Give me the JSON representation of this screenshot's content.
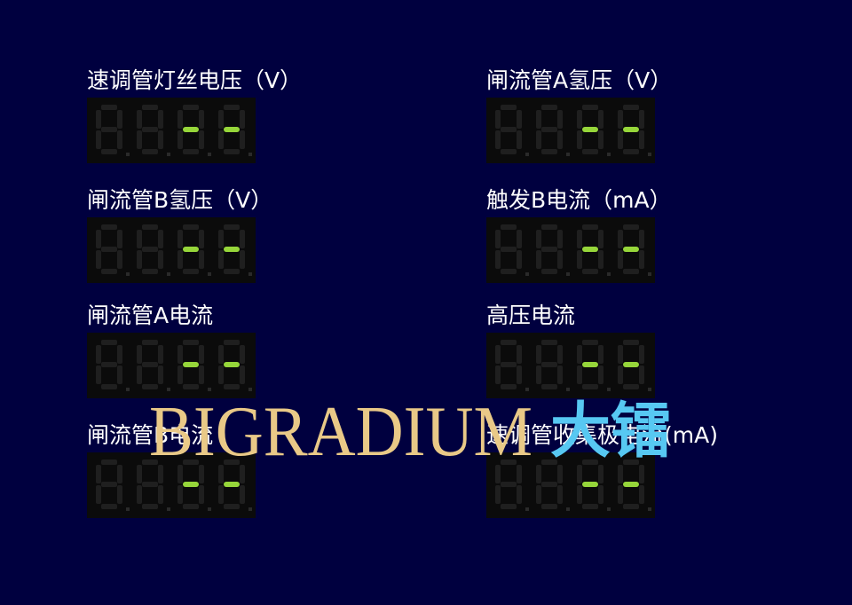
{
  "meters": [
    {
      "id": "m1",
      "label": "速调管灯丝电压（V）",
      "reading": "--"
    },
    {
      "id": "m2",
      "label": "闸流管A氢压（V）",
      "reading": "--"
    },
    {
      "id": "m3",
      "label": "闸流管B氢压（V）",
      "reading": "--"
    },
    {
      "id": "m4",
      "label": "触发B电流（mA）",
      "reading": "--"
    },
    {
      "id": "m5",
      "label": "闸流管A电流",
      "reading": "--"
    },
    {
      "id": "m6",
      "label": "高压电流",
      "reading": "--"
    },
    {
      "id": "m7",
      "label": "闸流管B电流",
      "reading": "--"
    },
    {
      "id": "m8",
      "label": "速调管收集极电流(mA)",
      "reading": "--"
    }
  ],
  "watermark": {
    "latin": "BIGRADIUM",
    "cjk": "大镭",
    "latin_color": "#e9c987",
    "cjk_color": "#57c8f2"
  },
  "colors": {
    "background": "#00003f",
    "segment_on": "#96d63a",
    "segment_off": "#1f1f1f"
  }
}
